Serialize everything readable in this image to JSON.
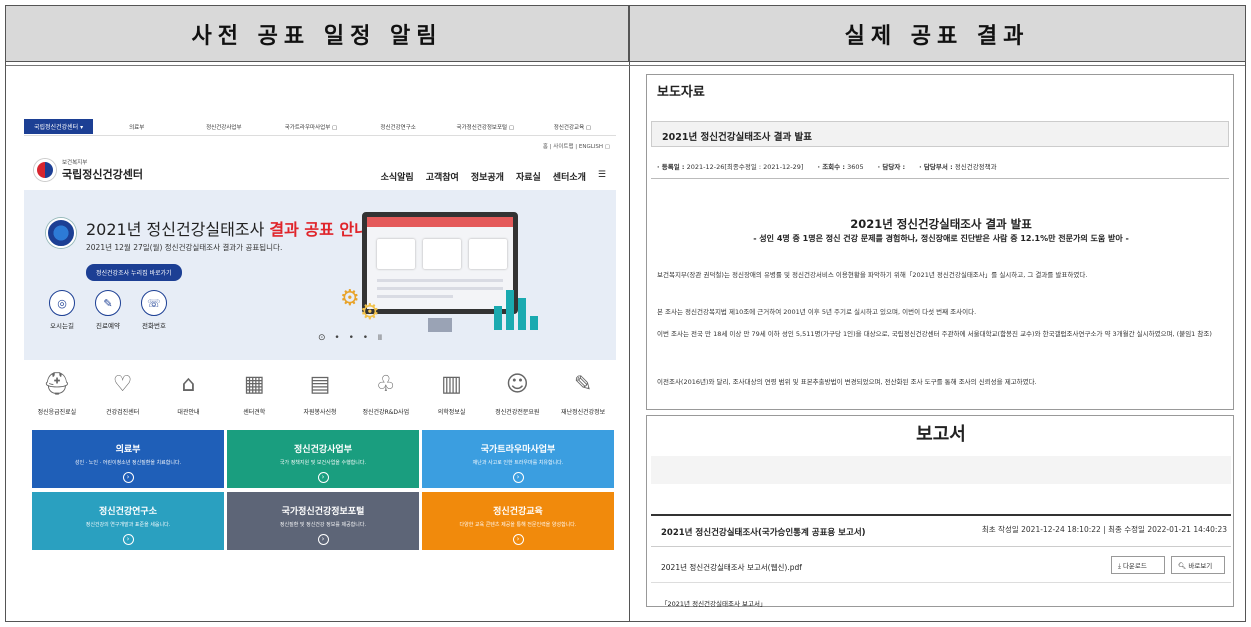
{
  "headers": {
    "left": "사전 공표 일정 알림",
    "right": "실제 공표 결과"
  },
  "left": {
    "topnav": {
      "active": "국립정신건강센터 ▾",
      "items": [
        "의료부",
        "정신건강사업부",
        "국가트라우마사업부 ▢",
        "정신건강연구소",
        "국가정신건강정보포털 ▢",
        "정신건강교육 ▢"
      ]
    },
    "util": "홈 | 사이트맵 | ENGLISH ▢",
    "logo": {
      "small": "보건복지부",
      "big": "국립정신건강센터"
    },
    "gnav": [
      "소식알림",
      "고객참여",
      "정보공개",
      "자료실",
      "센터소개",
      "☰"
    ],
    "hero": {
      "title_a": "2021년 정신건강실태조사 ",
      "title_b": "결과 공표 안내",
      "sub": "2021년 12월 27일(월) 정신건강실태조사 결과가 공표됩니다.",
      "button": "정신건강조사 누리집 바로가기",
      "quick": [
        {
          "icon": "◎",
          "label": "오시는길"
        },
        {
          "icon": "✎",
          "label": "진료예약"
        },
        {
          "icon": "☏",
          "label": "전화번호"
        }
      ],
      "dots": "⊙ • • • ॥"
    },
    "services": [
      {
        "icon": "⛑",
        "label": "정신응급진료실"
      },
      {
        "icon": "♡",
        "label": "건강검진센터"
      },
      {
        "icon": "⌂",
        "label": "대관안내"
      },
      {
        "icon": "▦",
        "label": "센터견학"
      },
      {
        "icon": "▤",
        "label": "자원봉사신청"
      },
      {
        "icon": "♧",
        "label": "정신건강R&D사업"
      },
      {
        "icon": "▥",
        "label": "의학정보실"
      },
      {
        "icon": "☺",
        "label": "정신건강전문요원"
      },
      {
        "icon": "✎",
        "label": "재난정신건강정보"
      }
    ],
    "tiles": [
      {
        "title": "의료부",
        "desc": "성인 · 노인 · 어린이청소년 정신질환을 치료합니다.",
        "color": "#1f5fb8"
      },
      {
        "title": "정신건강사업부",
        "desc": "국가 정책지원 및 보건사업을 수행합니다.",
        "color": "#1a9e7f"
      },
      {
        "title": "국가트라우마사업부",
        "desc": "재난과 사고로 인한 트라우마를 치유합니다.",
        "color": "#3b9ee0"
      },
      {
        "title": "정신건강연구소",
        "desc": "정신건강의 연구개발과 표준을 세웁니다.",
        "color": "#2aa0c0"
      },
      {
        "title": "국가정신건강정보포털",
        "desc": "정신질환 및 정신건강 정보를 제공합니다.",
        "color": "#5d6577"
      },
      {
        "title": "정신건강교육",
        "desc": "다양한 교육 콘텐츠 제공을 통해 전문인력을 양성합니다.",
        "color": "#f18a0c"
      }
    ],
    "tile_icon": "›"
  },
  "press": {
    "title": "보도자료",
    "subject": "2021년 정신건강실태조사 결과 발표",
    "meta": [
      {
        "k": "· 등록일 :",
        "v": " 2021-12-26[최종수정일 : 2021-12-29]"
      },
      {
        "k": "· 조회수 :",
        "v": " 3605"
      },
      {
        "k": "· 담당자 :",
        "v": ""
      },
      {
        "k": "· 담당부서 :",
        "v": " 정신건강정책과"
      }
    ],
    "headline": "2021년 정신건강실태조사 결과 발표",
    "subhead": "- 성인 4명 중 1명은 정신 건강 문제를 경험하나, 정신장애로 진단받은 사람 중 12.1%만 전문가의 도움 받아 -",
    "paras": [
      "보건복지부(장관 권덕철)는 정신장애의 유병률 및 정신건강서비스 이용현황을 파악하기 위해「2021년 정신건강실태조사」를 실시하고, 그 결과를 발표하였다.",
      "본 조사는 정신건강복지법 제10조에 근거하여 2001년 이후 5년 주기로 실시하고 있으며, 이번이 다섯 번째 조사이다.",
      "이번 조사는 전국 만 18세 이상 만 79세 이하 성인 5,511명(가구당 1인)을 대상으로, 국립정신건강센터 주관하에 서울대학교(함봉진 교수)와 한국갤럽조사연구소가 약 3개월간 실시하였으며, (붙임1 참조)",
      "이전조사(2016년)와 달리, 조사대상의 연령 범위 및 표본추출방법이 변경되었으며, 전산화된 조사 도구를 통해 조사의 신뢰성을 제고하였다."
    ]
  },
  "report": {
    "heading": "보고서",
    "title": "2021년 정신건강실태조사(국가승인통계 공표용 보고서)",
    "dates": "최초 작성일 2021-12-24 18:10:22 | 최종 수정일 2022-01-21 14:40:23",
    "file": "2021년 정신건강실태조사 보고서(웹신).pdf",
    "download": "⤓ 다운로드",
    "view": "🔍︎ 바로보기",
    "footer": "「2021년 정신건강실태조사 보고서」"
  }
}
